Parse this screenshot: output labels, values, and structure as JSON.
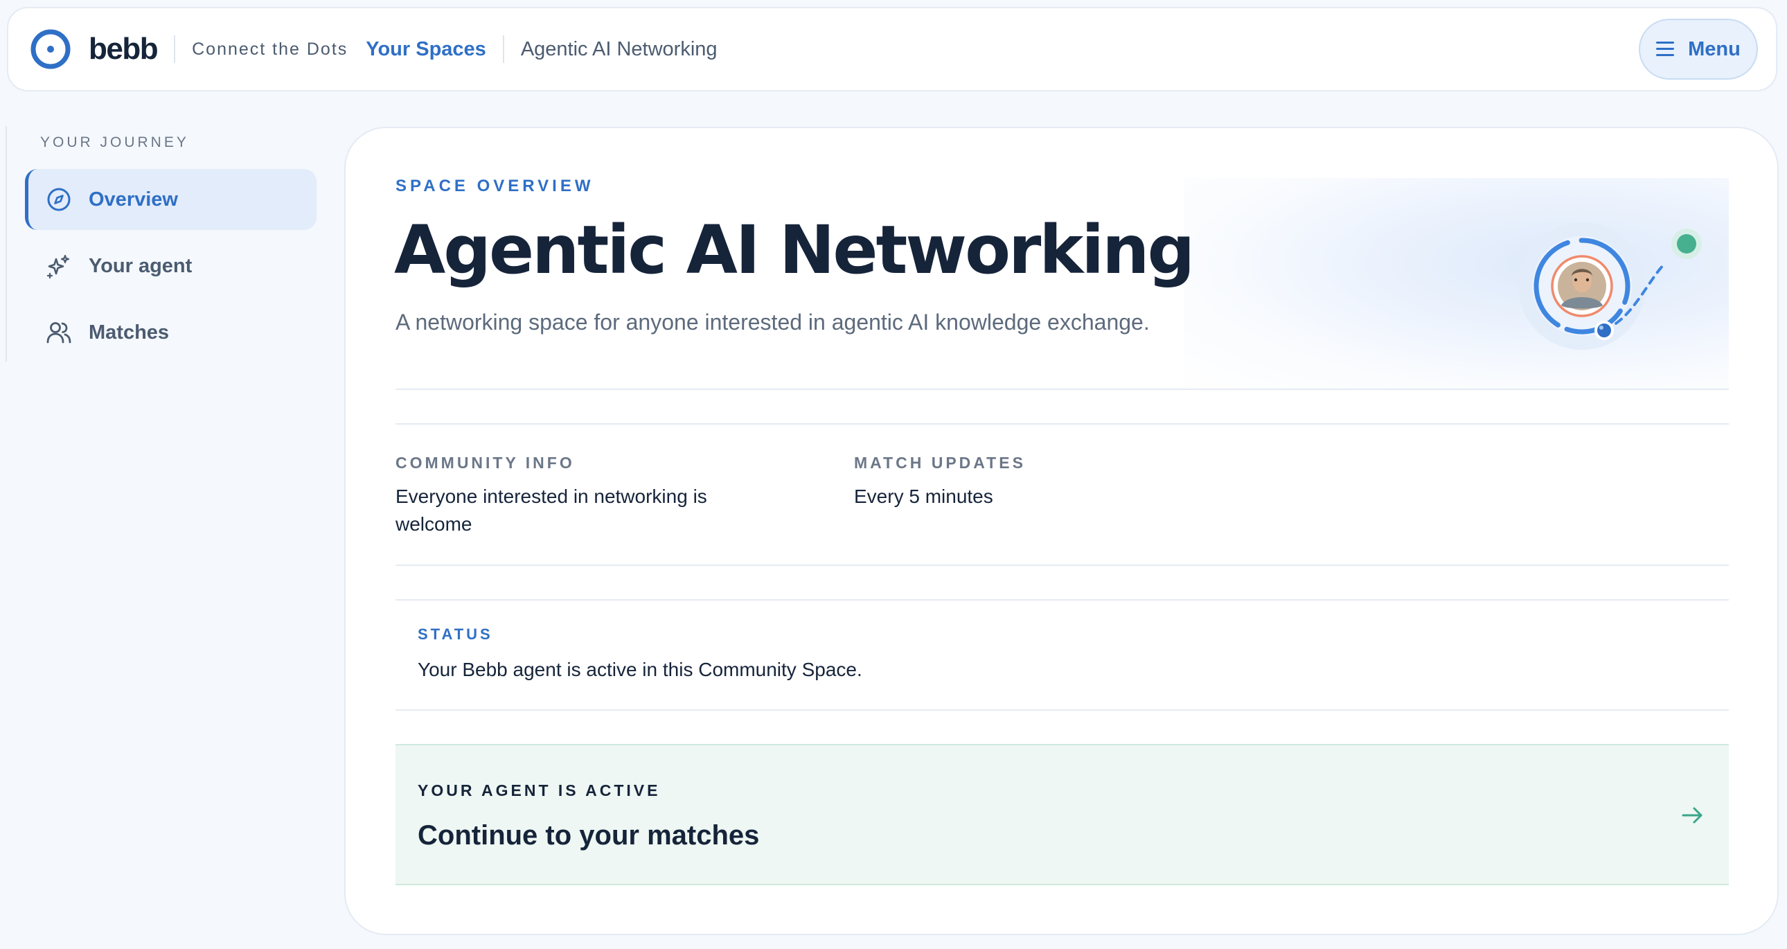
{
  "header": {
    "brand": "bebb",
    "tagline": "Connect the Dots",
    "nav_link": "Your Spaces",
    "breadcrumb": "Agentic AI Networking",
    "menu_label": "Menu"
  },
  "sidebar": {
    "title": "YOUR JOURNEY",
    "items": [
      {
        "label": "Overview",
        "icon": "compass-icon",
        "active": true
      },
      {
        "label": "Your agent",
        "icon": "sparkles-icon",
        "active": false
      },
      {
        "label": "Matches",
        "icon": "users-icon",
        "active": false
      }
    ]
  },
  "overview": {
    "eyebrow": "SPACE OVERVIEW",
    "title": "Agentic AI Networking",
    "description": "A networking space for anyone interested in agentic AI knowledge exchange.",
    "illustration": "avatar-orbit-illustration"
  },
  "info": {
    "community_label": "COMMUNITY INFO",
    "community_value": "Everyone interested in networking is welcome",
    "updates_label": "MATCH UPDATES",
    "updates_value": "Every 5 minutes"
  },
  "status": {
    "label": "STATUS",
    "text": "Your Bebb agent is active in this Community Space."
  },
  "cta": {
    "label": "YOUR AGENT IS ACTIVE",
    "title": "Continue to your matches",
    "icon": "arrow-right-icon"
  },
  "colors": {
    "accent": "#2f6fc6",
    "heading": "#16243a",
    "muted": "#5d6a7c",
    "success": "#3aa58a",
    "cta_bg": "#eef7f3",
    "page_bg": "#f5f8fc"
  }
}
